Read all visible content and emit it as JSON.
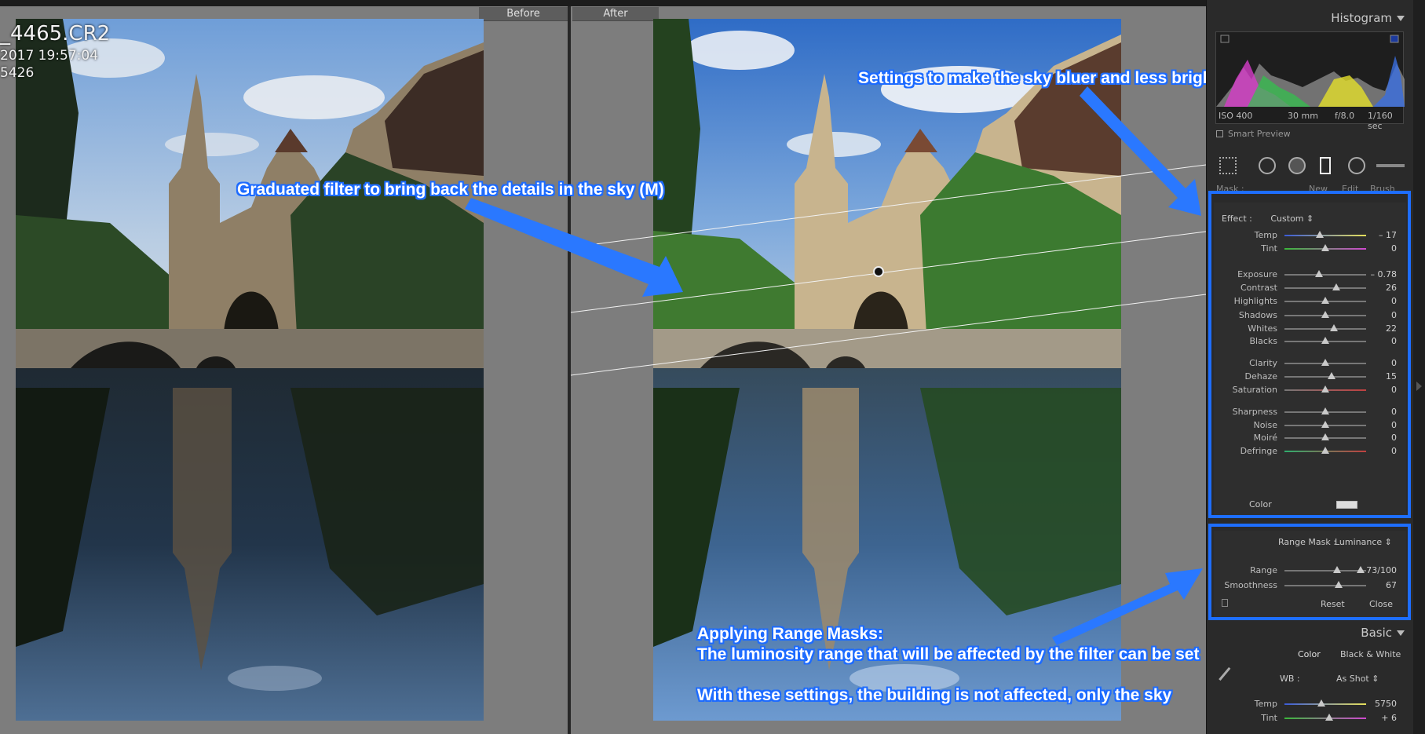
{
  "compare": {
    "before_label": "Before",
    "after_label": "After"
  },
  "file_info": {
    "filename": "_4465.CR2",
    "datetime": "2017 19:57:04",
    "line3": "5426"
  },
  "annotations": {
    "sky_settings": "Settings to make the sky bluer and less bright",
    "graduated_filter": "Graduated filter to bring back the details in the sky (M)",
    "range_masks_title": "Applying Range Masks:",
    "range_masks_line2": "The luminosity range that will be affected by the filter can be set",
    "range_masks_line3": "With these settings, the building is not affected, only the sky"
  },
  "panel": {
    "histogram": {
      "title": "Histogram",
      "iso": "ISO 400",
      "focal": "30 mm",
      "aperture": "f/8.0",
      "shutter": "1/160 sec",
      "smart_preview": "Smart Preview"
    },
    "mask_header": {
      "mask": "Mask :",
      "new": "New",
      "edit": "Edit",
      "brush": "Brush"
    },
    "effect": {
      "label": "Effect :",
      "value": "Custom ⇕"
    },
    "sliders": [
      {
        "name": "Temp",
        "value": "– 17",
        "pos": 0.43
      },
      {
        "name": "Tint",
        "value": "0",
        "pos": 0.5
      },
      {
        "name": "Exposure",
        "value": "– 0.78",
        "pos": 0.42
      },
      {
        "name": "Contrast",
        "value": "26",
        "pos": 0.63
      },
      {
        "name": "Highlights",
        "value": "0",
        "pos": 0.5
      },
      {
        "name": "Shadows",
        "value": "0",
        "pos": 0.5
      },
      {
        "name": "Whites",
        "value": "22",
        "pos": 0.61
      },
      {
        "name": "Blacks",
        "value": "0",
        "pos": 0.5
      },
      {
        "name": "Clarity",
        "value": "0",
        "pos": 0.5
      },
      {
        "name": "Dehaze",
        "value": "15",
        "pos": 0.58
      },
      {
        "name": "Saturation",
        "value": "0",
        "pos": 0.5
      },
      {
        "name": "Sharpness",
        "value": "0",
        "pos": 0.5
      },
      {
        "name": "Noise",
        "value": "0",
        "pos": 0.5
      },
      {
        "name": "Moiré",
        "value": "0",
        "pos": 0.5
      },
      {
        "name": "Defringe",
        "value": "0",
        "pos": 0.5
      }
    ],
    "color_label": "Color",
    "range_mask": {
      "label": "Range Mask :",
      "value": "Luminance ⇕",
      "range_name": "Range",
      "range_value": "73/100",
      "smooth_name": "Smoothness",
      "smooth_value": "67",
      "reset": "Reset",
      "close": "Close"
    },
    "basic": {
      "title": "Basic",
      "color_tab": "Color",
      "bw_tab": "Black & White",
      "wb_label": "WB :",
      "wb_value": "As Shot ⇕",
      "temp_name": "Temp",
      "temp_value": "5750",
      "tint_name": "Tint",
      "tint_value": "+ 6"
    }
  },
  "colors": {
    "accent": "#1e6eff",
    "panel": "#2a2a2a",
    "section": "#2e2e2e"
  }
}
